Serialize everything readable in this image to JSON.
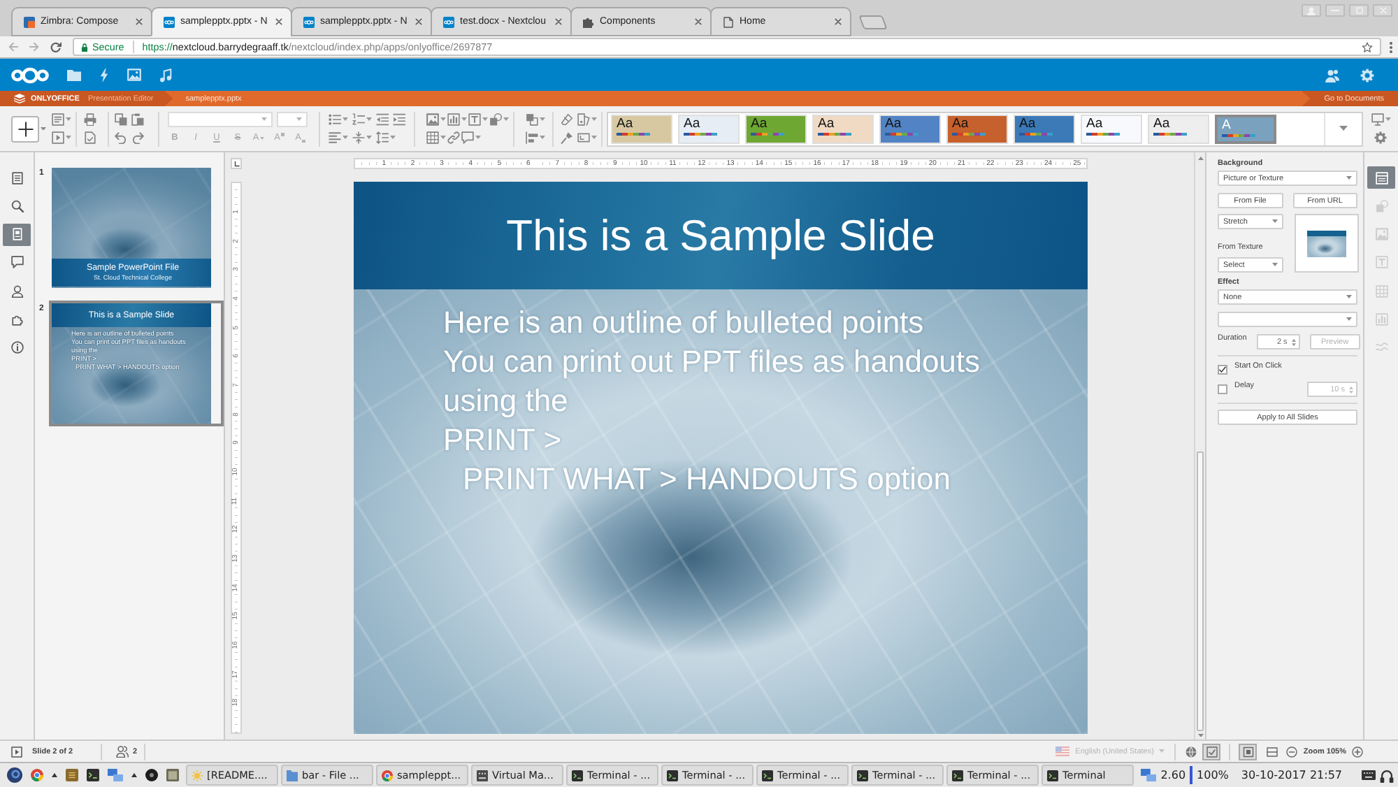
{
  "browser": {
    "tabs": [
      {
        "title": "Zimbra: Compose",
        "kind": "app",
        "selected": false
      },
      {
        "title": "samplepptx.pptx - N",
        "kind": "cloud",
        "selected": true
      },
      {
        "title": "samplepptx.pptx - N",
        "kind": "cloud",
        "selected": false
      },
      {
        "title": "test.docx - Nextclou",
        "kind": "cloud",
        "selected": false
      },
      {
        "title": "Components",
        "kind": "extension",
        "selected": false
      },
      {
        "title": "Home",
        "kind": "page",
        "selected": false
      }
    ],
    "security": "Secure",
    "url": {
      "scheme": "https://",
      "host": "nextcloud.barrydegraaff.tk",
      "path": "/nextcloud/index.php/apps/onlyoffice/2697877"
    }
  },
  "editor_header": {
    "brand": "ONLYOFFICE",
    "app": "Presentation Editor",
    "file": "samplepptx.pptx",
    "back_link": "Go to Documents"
  },
  "toolbar": {
    "font_buttons": [
      {
        "label": "B",
        "kind": "bold",
        "disabled": true
      },
      {
        "label": "I",
        "kind": "italic",
        "disabled": true
      },
      {
        "label": "U",
        "kind": "underline",
        "disabled": true
      },
      {
        "label": "S",
        "kind": "strike",
        "disabled": true
      },
      {
        "label": "A",
        "kind": "color",
        "disabled": true
      },
      {
        "label": "A",
        "kind": "superscript",
        "disabled": true
      },
      {
        "label": "A",
        "kind": "subscript",
        "disabled": true
      }
    ],
    "themes": [
      {
        "label": "Aa",
        "color": "#d8c8a2",
        "selected": false
      },
      {
        "label": "Aa",
        "color": "#e6edf5",
        "selected": false
      },
      {
        "label": "Aa",
        "color": "#6ea832",
        "selected": false
      },
      {
        "label": "Aa",
        "color": "#f0dac4",
        "selected": false
      },
      {
        "label": "Aa",
        "color": "#5283c4",
        "selected": false
      },
      {
        "label": "Aa",
        "color": "#c6602c",
        "selected": false
      },
      {
        "label": "Aa",
        "color": "#3b79b7",
        "selected": false
      },
      {
        "label": "Aa",
        "color": "#f7f9fc",
        "selected": false
      },
      {
        "label": "Aa",
        "color": "#eeeeee",
        "selected": false
      },
      {
        "label": "A",
        "color": "#7aa2bf",
        "selected": true
      }
    ]
  },
  "left_sidebar": {
    "items": [
      {
        "kind": "file",
        "selected": false
      },
      {
        "kind": "search",
        "selected": false
      },
      {
        "kind": "slides",
        "selected": true
      },
      {
        "kind": "comments",
        "selected": false
      },
      {
        "kind": "chat",
        "selected": false
      },
      {
        "kind": "plugins",
        "selected": false
      },
      {
        "kind": "about",
        "selected": false
      }
    ]
  },
  "slides_panel": {
    "slides": [
      {
        "number": "1",
        "kind": "title",
        "selected": false,
        "title": "Sample PowerPoint File",
        "subtitle": "St. Cloud Technical College"
      },
      {
        "number": "2",
        "kind": "content",
        "selected": true,
        "title": "This is a Sample Slide",
        "bullets": [
          {
            "text": "Here is an outline of bulleted points"
          },
          {
            "text": "You can print out PPT files as handouts"
          },
          {
            "text": "using the"
          },
          {
            "text": "PRINT >",
            "children": [
              {
                "text": "PRINT WHAT > HANDOUTS option"
              }
            ]
          }
        ]
      }
    ]
  },
  "canvas": {
    "ruler": {
      "horizontal": [
        "1",
        "2",
        "3",
        "4",
        "5",
        "6",
        "7",
        "8",
        "9",
        "10",
        "11",
        "12",
        "13",
        "14",
        "15",
        "16",
        "17",
        "18",
        "19",
        "20",
        "21",
        "22",
        "23",
        "24",
        "25"
      ],
      "vertical": [
        "1",
        "2",
        "3",
        "4",
        "5",
        "6",
        "7",
        "8",
        "9",
        "10",
        "11",
        "12",
        "13",
        "14",
        "15",
        "16",
        "17",
        "18"
      ]
    },
    "slide": {
      "title": "This is a Sample Slide",
      "bullets": [
        {
          "text": "Here is an outline of bulleted points"
        },
        {
          "text": "You can print out PPT files as handouts"
        },
        {
          "text": "using the"
        },
        {
          "text": "PRINT >",
          "children": [
            {
              "text": "PRINT WHAT > HANDOUTS option"
            }
          ]
        }
      ]
    }
  },
  "right_panel": {
    "section": "Background",
    "fill": "Picture or Texture",
    "from_file": "From File",
    "from_url": "From URL",
    "stretch": "Stretch",
    "texture_label": "From Texture",
    "texture": "Select",
    "effect_label": "Effect",
    "effect": "None",
    "duration_label": "Duration",
    "duration": "2 s",
    "preview": {
      "label": "Preview",
      "disabled": true
    },
    "start_on_click": {
      "label": "Start On Click",
      "checked": true
    },
    "delay": {
      "label": "Delay",
      "checked": false,
      "value": "10 s"
    },
    "apply": "Apply to All Slides"
  },
  "right_sidebar": {
    "items": [
      {
        "kind": "slide",
        "selected": true,
        "disabled": false
      },
      {
        "kind": "shape",
        "selected": false,
        "disabled": true
      },
      {
        "kind": "image",
        "selected": false,
        "disabled": true
      },
      {
        "kind": "text",
        "selected": false,
        "disabled": true
      },
      {
        "kind": "table",
        "selected": false,
        "disabled": true
      },
      {
        "kind": "chart",
        "selected": false,
        "disabled": true
      },
      {
        "kind": "text_art",
        "selected": false,
        "disabled": true
      }
    ]
  },
  "status_bar": {
    "slide_info": "Slide 2 of 2",
    "users": "2",
    "language": "English (United States)",
    "toggles": [
      {
        "kind": "spellcheck",
        "on": true
      },
      {
        "kind": "fit_slide",
        "on": true
      },
      {
        "kind": "fit_width",
        "on": false
      }
    ],
    "zoom": "Zoom 105%"
  },
  "taskbar": {
    "tasks": [
      {
        "label": "[README....",
        "kind": "editor"
      },
      {
        "label": "bar - File ...",
        "kind": "files"
      },
      {
        "label": "sampleppt...",
        "kind": "browser"
      },
      {
        "label": "Virtual Ma...",
        "kind": "vm"
      },
      {
        "label": "Terminal - ...",
        "kind": "terminal"
      },
      {
        "label": "Terminal - ...",
        "kind": "terminal"
      },
      {
        "label": "Terminal - ...",
        "kind": "terminal"
      },
      {
        "label": "Terminal - ...",
        "kind": "terminal"
      },
      {
        "label": "Terminal - ...",
        "kind": "terminal"
      },
      {
        "label": "Terminal",
        "kind": "terminal"
      }
    ],
    "tray": {
      "load": "2.60",
      "battery": "100%",
      "clock": "30-10-2017 21:57"
    }
  }
}
